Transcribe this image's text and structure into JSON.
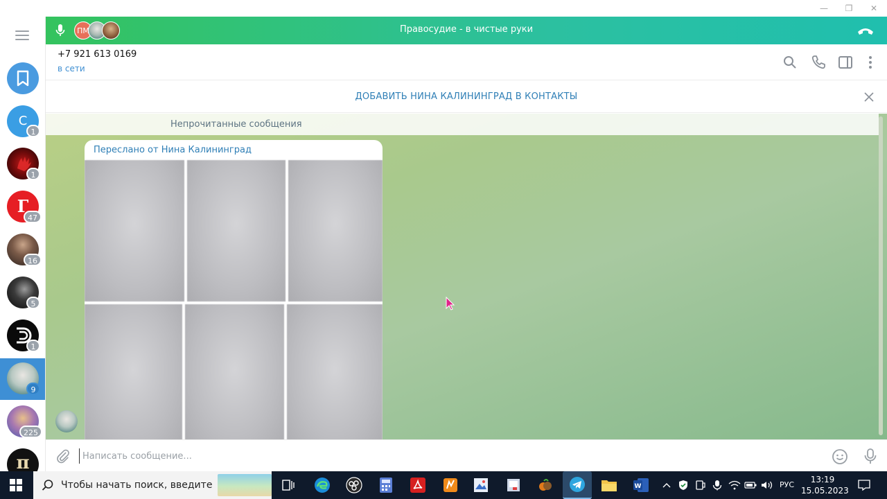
{
  "call_bar": {
    "title": "Правосудие - в чистые руки",
    "initials": "ПМ",
    "colors": {
      "start": "#34c35e",
      "end": "#20bfae"
    }
  },
  "chat_header": {
    "phone": "+7 921 613 0169",
    "status": "в сети"
  },
  "add_contact": {
    "label": "ДОБАВИТЬ НИНА КАЛИНИНГРАД В КОНТАКТЫ"
  },
  "messages": {
    "unread_label": "Непрочитанные сообщения",
    "forwarded_label": "Переслано от Нина Калининград"
  },
  "compose": {
    "placeholder": "Написать сообщение..."
  },
  "sidebar": {
    "chats": [
      {
        "name": "saved-messages",
        "badge": ""
      },
      {
        "name": "chat-c",
        "letter": "С",
        "badge": "1"
      },
      {
        "name": "chat-red-hand",
        "badge": "1"
      },
      {
        "name": "chat-g",
        "letter": "Г",
        "badge": "47"
      },
      {
        "name": "chat-man",
        "badge": "16"
      },
      {
        "name": "chat-dark-portrait",
        "badge": "5"
      },
      {
        "name": "chat-logo-b",
        "badge": "1"
      },
      {
        "name": "chat-woman-active",
        "badge": "9"
      },
      {
        "name": "chat-colorful",
        "badge": "225"
      },
      {
        "name": "chat-p-logo",
        "letter": "п",
        "badge": ""
      }
    ]
  },
  "taskbar": {
    "search_placeholder": "Чтобы начать поиск, введите",
    "language": "РУС",
    "time": "13:19",
    "date": "15.05.2023"
  }
}
